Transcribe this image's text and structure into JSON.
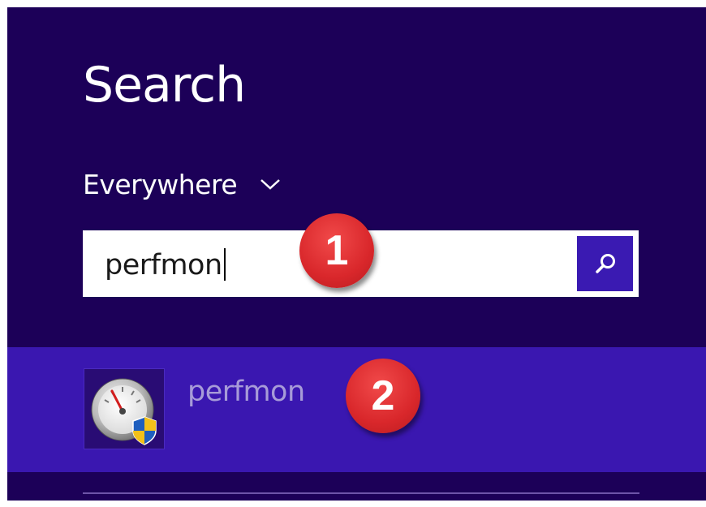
{
  "header": {
    "title": "Search",
    "scope_label": "Everywhere",
    "scope_icon": "chevron-down-icon"
  },
  "search": {
    "value": "perfmon",
    "button_icon": "search-icon"
  },
  "results": [
    {
      "label": "perfmon",
      "icon": "performance-gauge-icon"
    }
  ],
  "annotations": [
    "1",
    "2"
  ],
  "colors": {
    "panel_background": "#1c0058",
    "search_button": "#3a1ab2",
    "result_highlight": "#3a17b0",
    "badge": "#d9272b"
  }
}
